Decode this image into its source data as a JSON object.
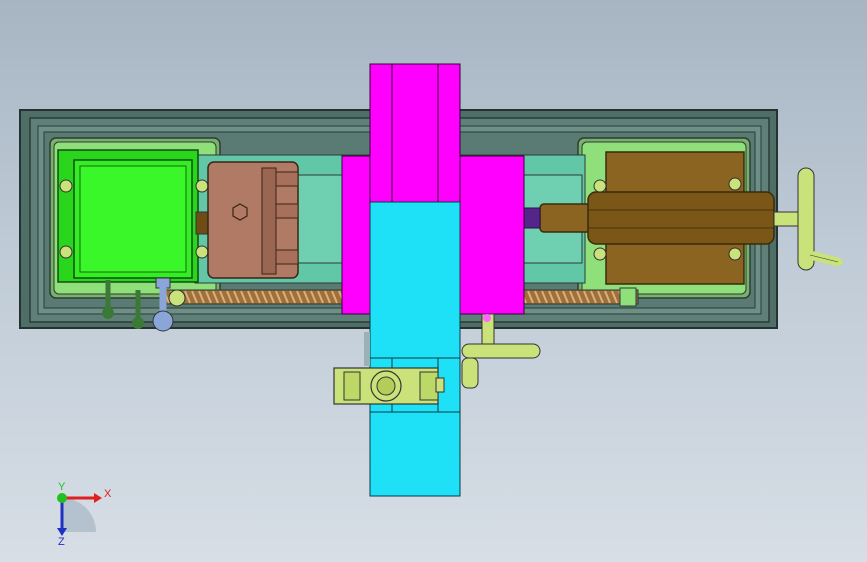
{
  "viewport": {
    "background_top": "#a7b5c3",
    "background_bottom": "#d7dee6"
  },
  "model": {
    "colors": {
      "bed_frame": "#5b7a72",
      "bed_inner": "#6c8c84",
      "rail": "#8fe07a",
      "headstock_motor": "#33ee22",
      "chuck": "#b07a64",
      "carriage_way": "#62c7a7",
      "cross_slide": "#ff00ff",
      "tool_post": "#1ee0f6",
      "handwheel": "#c9e37a",
      "lead_screw": "#c89862",
      "tailstock_body": "#8a6420",
      "tailstock_quill": "#6d4d14",
      "lever_knob_green": "#3a7a36",
      "lever_knob_blue": "#8aa6d8",
      "drill_tip": "#55268a"
    }
  },
  "triad": {
    "x_label": "X",
    "y_label": "Y",
    "z_label": "Z",
    "x_color": "#e02020",
    "y_color": "#20c020",
    "z_color": "#2030c0"
  }
}
